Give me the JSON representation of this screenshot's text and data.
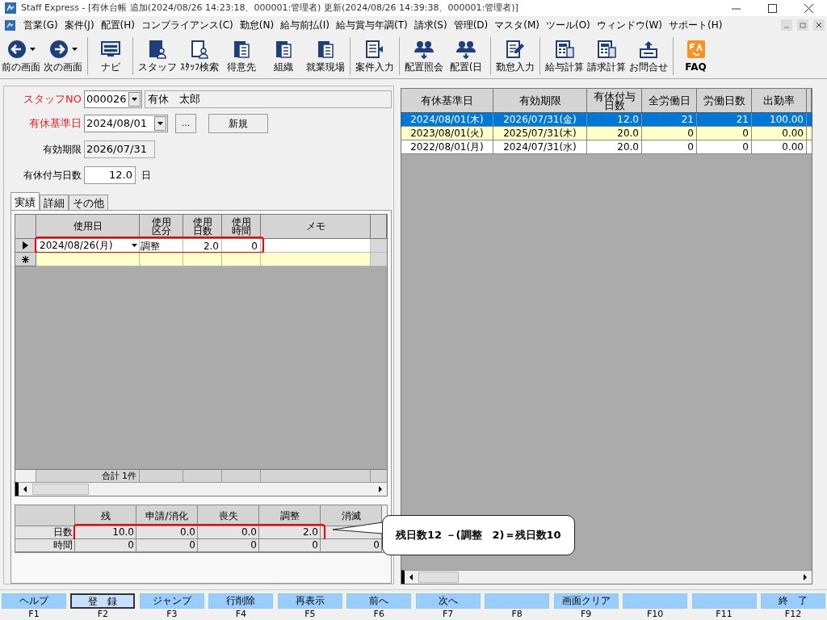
{
  "window": {
    "title": "Staff Express - [有休台帳  追加(2024/08/26 14:23:18、000001:管理者)  更新(2024/08/26 14:39:38、000001:管理者)]"
  },
  "menu": [
    "営業(G)",
    "案件(J)",
    "配置(H)",
    "コンプライアンス(C)",
    "勤怠(N)",
    "給与前払(I)",
    "給与賞与年調(T)",
    "請求(S)",
    "管理(D)",
    "マスタ(M)",
    "ツール(O)",
    "ウィンドウ(W)",
    "サポート(H)"
  ],
  "toolbar": [
    {
      "label": "前の画面",
      "kind": "back",
      "dropdown": true,
      "group_start": false
    },
    {
      "label": "次の画面",
      "kind": "forward",
      "dropdown": true,
      "group_start": false
    },
    {
      "label": "ナビ",
      "kind": "navi",
      "dropdown": false,
      "group_start": true
    },
    {
      "label": "スタッフ",
      "kind": "person",
      "dropdown": false,
      "group_start": true
    },
    {
      "label": "ｽﾀｯﾌ検索",
      "kind": "person-search",
      "dropdown": false,
      "group_start": false
    },
    {
      "label": "得意先",
      "kind": "building",
      "dropdown": false,
      "group_start": false
    },
    {
      "label": "組織",
      "kind": "building",
      "dropdown": false,
      "group_start": false
    },
    {
      "label": "就業現場",
      "kind": "building",
      "dropdown": false,
      "group_start": false
    },
    {
      "label": "案件入力",
      "kind": "document",
      "dropdown": false,
      "group_start": true
    },
    {
      "label": "配置照会",
      "kind": "people",
      "dropdown": false,
      "group_start": true
    },
    {
      "label": "配置(日",
      "kind": "people",
      "dropdown": false,
      "group_start": false
    },
    {
      "label": "勤怠入力",
      "kind": "edit",
      "dropdown": false,
      "group_start": true
    },
    {
      "label": "給与計算",
      "kind": "calculator",
      "dropdown": false,
      "group_start": true
    },
    {
      "label": "請求計算",
      "kind": "calculator",
      "dropdown": false,
      "group_start": false
    },
    {
      "label": "お問合せ",
      "kind": "upload",
      "dropdown": false,
      "group_start": false
    },
    {
      "label": "FAQ",
      "kind": "faq",
      "dropdown": false,
      "group_start": true
    }
  ],
  "form": {
    "staff_no_label": "スタッフNO",
    "staff_no": "000026",
    "staff_name": "有休　太郎",
    "base_date_label": "有休基準日",
    "base_date": "2024/08/01",
    "browse_button": "...",
    "new_button": "新規",
    "expiry_label": "有効期限",
    "expiry": "2026/07/31",
    "grant_label": "有休付与日数",
    "grant_days": "12.0",
    "grant_unit": "日"
  },
  "tabs": [
    {
      "label": "実績",
      "selected": true
    },
    {
      "label": "詳細",
      "selected": false
    },
    {
      "label": "その他",
      "selected": false
    }
  ],
  "usage_table": {
    "columns": [
      "使用日",
      "使用区分",
      "使用日数",
      "使用時間",
      "メモ"
    ],
    "rows": [
      {
        "kind": "current",
        "highlighted": true,
        "date": "2024/08/26(月)",
        "category": "調整",
        "days": "2.0",
        "hours": "0",
        "memo": ""
      },
      {
        "kind": "new",
        "highlighted": false,
        "date": "",
        "category": "",
        "days": "",
        "hours": "",
        "memo": ""
      }
    ],
    "footer": "合計 1件"
  },
  "summary": {
    "columns": [
      "残",
      "申請/消化",
      "喪失",
      "調整",
      "消滅"
    ],
    "rows": [
      {
        "label": "日数",
        "highlighted": true,
        "values": [
          "10.0",
          "0.0",
          "0.0",
          "2.0"
        ]
      },
      {
        "label": "時間",
        "highlighted": false,
        "values": [
          "0",
          "0",
          "0",
          "0",
          "0"
        ]
      }
    ]
  },
  "callout": "残日数12 －(調整　2)＝残日数10",
  "history_table": {
    "columns": [
      "有休基準日",
      "有効期限",
      "有休付与日数",
      "全労働日",
      "労働日数",
      "出勤率"
    ],
    "rows": [
      {
        "selected": true,
        "color": "#0078d7",
        "cells": [
          "2024/08/01(木)",
          "2026/07/31(金)",
          "12.0",
          "21",
          "21",
          "100.00"
        ]
      },
      {
        "selected": false,
        "color": "#ffffc8",
        "cells": [
          "2023/08/01(火)",
          "2025/07/31(木)",
          "20.0",
          "0",
          "0",
          "0.00"
        ]
      },
      {
        "selected": false,
        "color": "#ffffff",
        "cells": [
          "2022/08/01(月)",
          "2024/07/31(水)",
          "20.0",
          "0",
          "0",
          "0.00"
        ]
      }
    ]
  },
  "function_keys": [
    {
      "label": "ヘルプ",
      "key": "F1",
      "focused": false
    },
    {
      "label": "登　録",
      "key": "F2",
      "focused": true
    },
    {
      "label": "ジャンプ",
      "key": "F3",
      "focused": false
    },
    {
      "label": "行削除",
      "key": "F4",
      "focused": false
    },
    {
      "label": "再表示",
      "key": "F5",
      "focused": false
    },
    {
      "label": "前へ",
      "key": "F6",
      "focused": false
    },
    {
      "label": "次へ",
      "key": "F7",
      "focused": false
    },
    {
      "key": "F8",
      "focused": false
    },
    {
      "label": "画面クリア",
      "key": "F9",
      "focused": false
    },
    {
      "key": "F10",
      "focused": false
    },
    {
      "key": "F11",
      "focused": false
    },
    {
      "label": "終　了",
      "key": "F12",
      "focused": false
    }
  ]
}
